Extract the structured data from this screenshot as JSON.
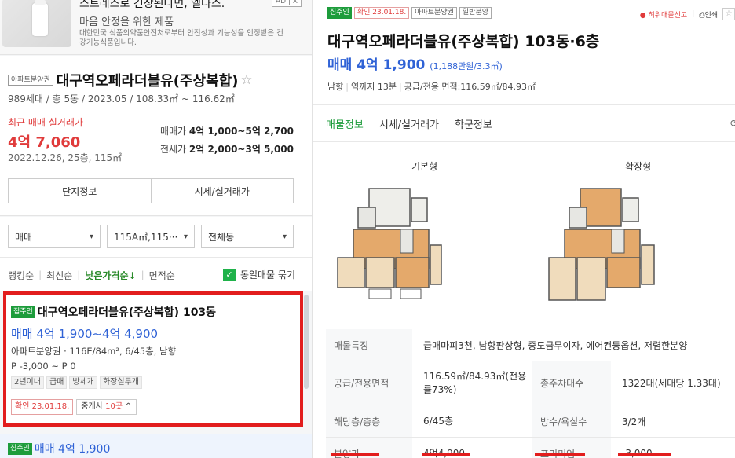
{
  "ad": {
    "title": "스트레스로 긴장된다면, 엘나스.",
    "subtitle": "마음 안정을 위한 제품",
    "desc": "대한민국 식품의약품안전처로부터 안전성과 기능성을 인정받은 건강기능식품입니다.",
    "badge": "AD | X"
  },
  "complex": {
    "type_tag": "아파트분양권",
    "name": "대구역오페라더블유(주상복합)",
    "info": "989세대 / 총 5동 / 2023.05 / 108.33㎡ ~ 116.62㎡",
    "recent_label": "최근 매매 실거래가",
    "recent_price": "4억 7,060",
    "recent_date": "2022.12.26, 25층, 115㎡",
    "sale_label": "매매가",
    "sale_range": "4억 1,000~5억 2,700",
    "jeonse_label": "전세가",
    "jeonse_range": "2억 2,000~3억 5,000",
    "btn_info": "단지정보",
    "btn_price": "시세/실거래가"
  },
  "filters": {
    "trade": "매매",
    "area": "115A㎡,115···",
    "building": "전체동"
  },
  "sort": {
    "ranking": "랭킹순",
    "latest": "최신순",
    "low_price": "낮은가격순↓",
    "area": "면적순",
    "group_label": "동일매물 묶기"
  },
  "listing": {
    "tag": "집주인",
    "title": "대구역오페라더블유(주상복합) 103동",
    "price": "매매 4억 1,900~4억 4,900",
    "spec": "아파트분양권 · 116E/84m², 6/45층, 남향",
    "premium": "P -3,000 ~ P 0",
    "tags": [
      "2년이내",
      "급매",
      "방세개",
      "화장실두개"
    ],
    "confirm": "확인 23.01.18.",
    "agents_label": "중개사",
    "agents_count": "10곳",
    "agents_chev": "^"
  },
  "listing2": {
    "tag": "집주인",
    "price": "매매 4억 1,900"
  },
  "detail": {
    "tags": [
      "집주인",
      "확인 23.01.18.",
      "아파트분양권",
      "일반분양"
    ],
    "report": "허위매물신고",
    "print": "인쇄",
    "title": "대구역오페라더블유(주상복합) 103동·6층",
    "price": "매매 4억 1,900",
    "price_per": "(1,188만원/3.3㎡)",
    "direction": "남향",
    "station": "역까지 13분",
    "area": "공급/전용 면적:116.59㎡/84.93㎡",
    "tabs": [
      "매물정보",
      "시세/실거래가",
      "학군정보"
    ],
    "plan_basic": "기본형",
    "plan_ext": "확장형",
    "feature_label": "매물특징",
    "feature": "급매마피3천, 남향판상형, 중도금무이자, 에어컨등옵션, 저렴한분양",
    "area_label": "공급/전용면적",
    "area_value": "116.59㎡/84.93㎡(전용률73%)",
    "parking_label": "총주차대수",
    "parking_value": "1322대(세대당 1.33대)",
    "floor_label": "해당층/총층",
    "floor_value": "6/45층",
    "rooms_label": "방수/욕실수",
    "rooms_value": "3/2개",
    "sale_label": "분양가",
    "sale_value": "4억4,900",
    "premium_label": "프리미엄",
    "premium_value": "-3,000"
  }
}
